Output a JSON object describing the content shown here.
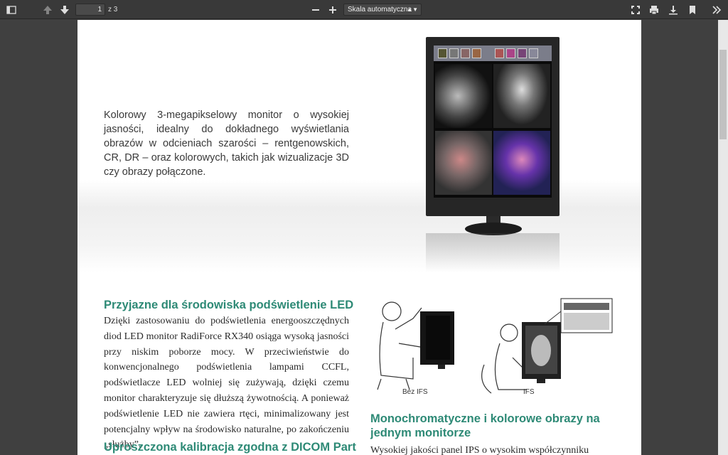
{
  "toolbar": {
    "page_current": "1",
    "page_total": "z 3",
    "zoom": "Skala automatyczna",
    "icons": [
      "sidebar-toggle-icon",
      "page-up-icon",
      "page-down-icon",
      "zoom-out-icon",
      "zoom-in-icon",
      "fullscreen-icon",
      "print-icon",
      "download-icon",
      "bookmark-icon",
      "more-tools-icon"
    ]
  },
  "document": {
    "intro": "Kolorowy 3-megapikselowy monitor o wysokiej jasności, idealny do dokładnego wyświetlania obrazów w odcieniach szarości – rentgenowskich, CR, DR – oraz kolorowych, takich jak wizualizacje 3D czy obrazy połączone.",
    "led_heading": "Przyjazne dla środowiska podświetlenie LED",
    "led_body": "Dzięki zastosowaniu do podświetlenia energooszczędnych diod LED monitor RadiForce RX340 osiąga wysoką jasności przy niskim poborze mocy. W przeciwieństwie do konwencjonalnego podświetlenia lampami CCFL, podświetlacze LED wolniej się zużywają, dzięki czemu monitor charakteryzuje się dłuższą żywotnością. A ponieważ podświetlenie LED nie zawiera rtęci, minimalizowany jest potencjalny wpływ na środowisko naturalne, po zakończeniu „służby”.",
    "fig_label_left": "Bez IFS",
    "fig_label_right": "IFS",
    "mono_heading": "Monochromatyczne i kolorowe obrazy na jednym monitorze",
    "mono_body": "Wysokiej jakości panel IPS o wysokim współczynniku kontra-",
    "cal_heading": "Uproszczona kalibracja zgodna z DICOM Part"
  },
  "colors": {
    "heading": "#2e8a76",
    "toolbar": "#393939",
    "viewer_bg": "#404040"
  }
}
